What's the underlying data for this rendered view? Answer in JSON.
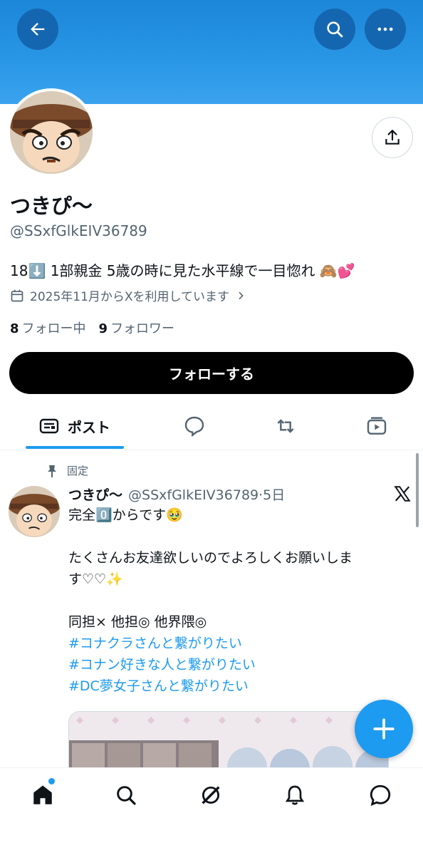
{
  "profile": {
    "display_name": "つきぴ〜",
    "handle": "@SSxfGlkEIV36789",
    "bio_text": "18⬇️ 1部親金 5歳の時に見た水平線で一目惚れ",
    "bio_emojis": "🙈💕",
    "joined": "2025年11月からXを利用しています",
    "following_count": "8",
    "following_label": "フォロー中",
    "followers_count": "9",
    "followers_label": "フォロワー",
    "follow_button": "フォローする"
  },
  "tabs": {
    "posts_label": "ポスト"
  },
  "pinned_post": {
    "pinned_label": "固定",
    "name": "つきぴ〜",
    "handle_time": "@SSxfGlkEIV36789·5日",
    "lines": [
      "完全0️⃣からです🥹",
      "",
      "たくさんお友達欲しいのでよろしくお願いしま",
      "す♡♡✨",
      "",
      "同担× 他担◎ 他界隈◎"
    ],
    "hashtags": [
      "#コナクラさんと繋がりたい",
      "#コナン好きな人と繋がりたい",
      "#DC夢女子さんと繋がりたい"
    ]
  },
  "colors": {
    "accent": "#1d9bf0",
    "banner": "#2a97e6",
    "nav_button": "#1566b0"
  },
  "icons": [
    "back-arrow-icon",
    "search-icon",
    "more-icon",
    "share-icon",
    "calendar-icon",
    "chevron-right-icon",
    "posts-icon",
    "reply-icon",
    "repost-icon",
    "media-icon",
    "pin-icon",
    "x-logo-icon",
    "plus-icon",
    "home-icon",
    "grok-icon",
    "bell-icon",
    "message-icon"
  ]
}
